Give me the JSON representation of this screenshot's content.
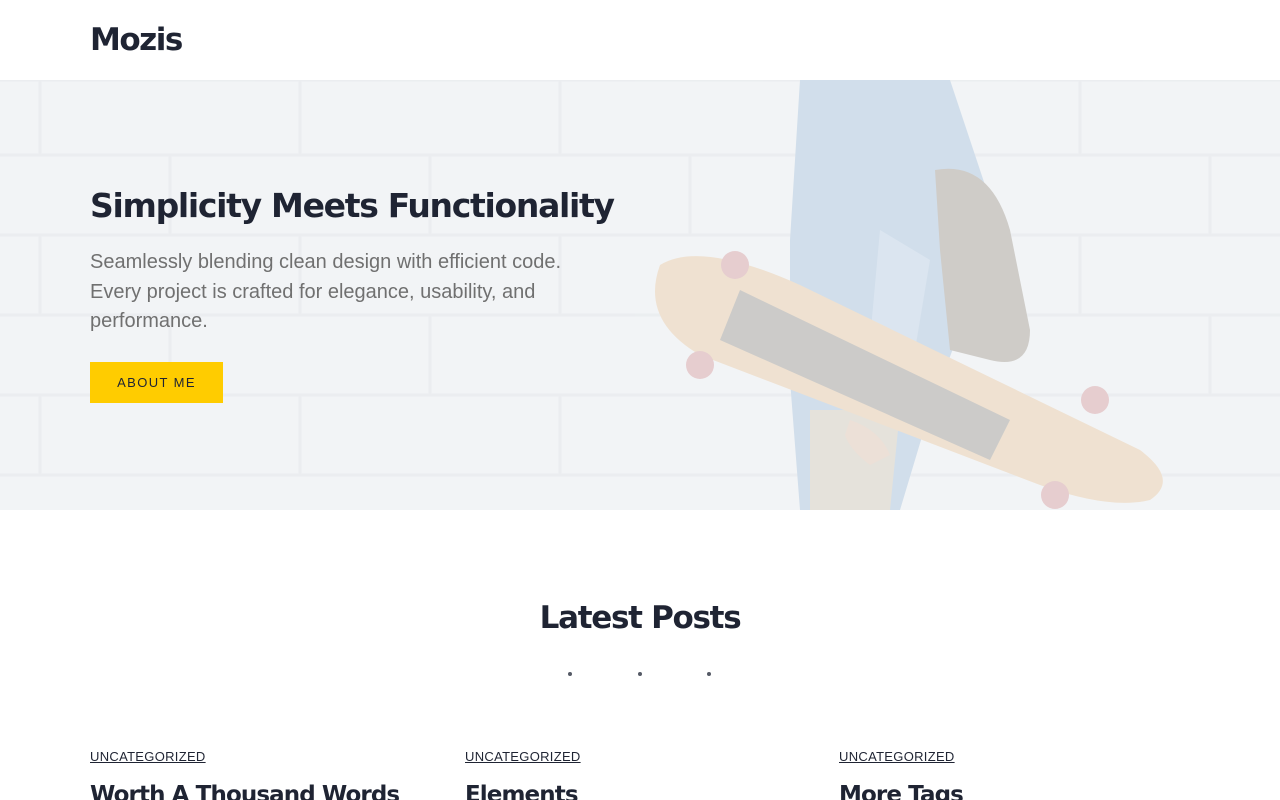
{
  "header": {
    "site_title": "Mozis"
  },
  "hero": {
    "title": "Simplicity Meets Functionality",
    "text": "Seamlessly blending clean design with efficient code. Every project is crafted for elegance, usability, and performance.",
    "button_label": "ABOUT ME",
    "image": "skateboarder-with-longboard-and-backpack"
  },
  "latest_posts": {
    "title": "Latest Posts",
    "posts": [
      {
        "category": "UNCATEGORIZED",
        "title": "Worth A Thousand Words"
      },
      {
        "category": "UNCATEGORIZED",
        "title": "Elements"
      },
      {
        "category": "UNCATEGORIZED",
        "title": "More Tags"
      }
    ]
  },
  "colors": {
    "accent": "#ffcc00",
    "text_dark": "#1f2433",
    "text_muted": "#707070",
    "hero_background": "#f1f2f4"
  }
}
